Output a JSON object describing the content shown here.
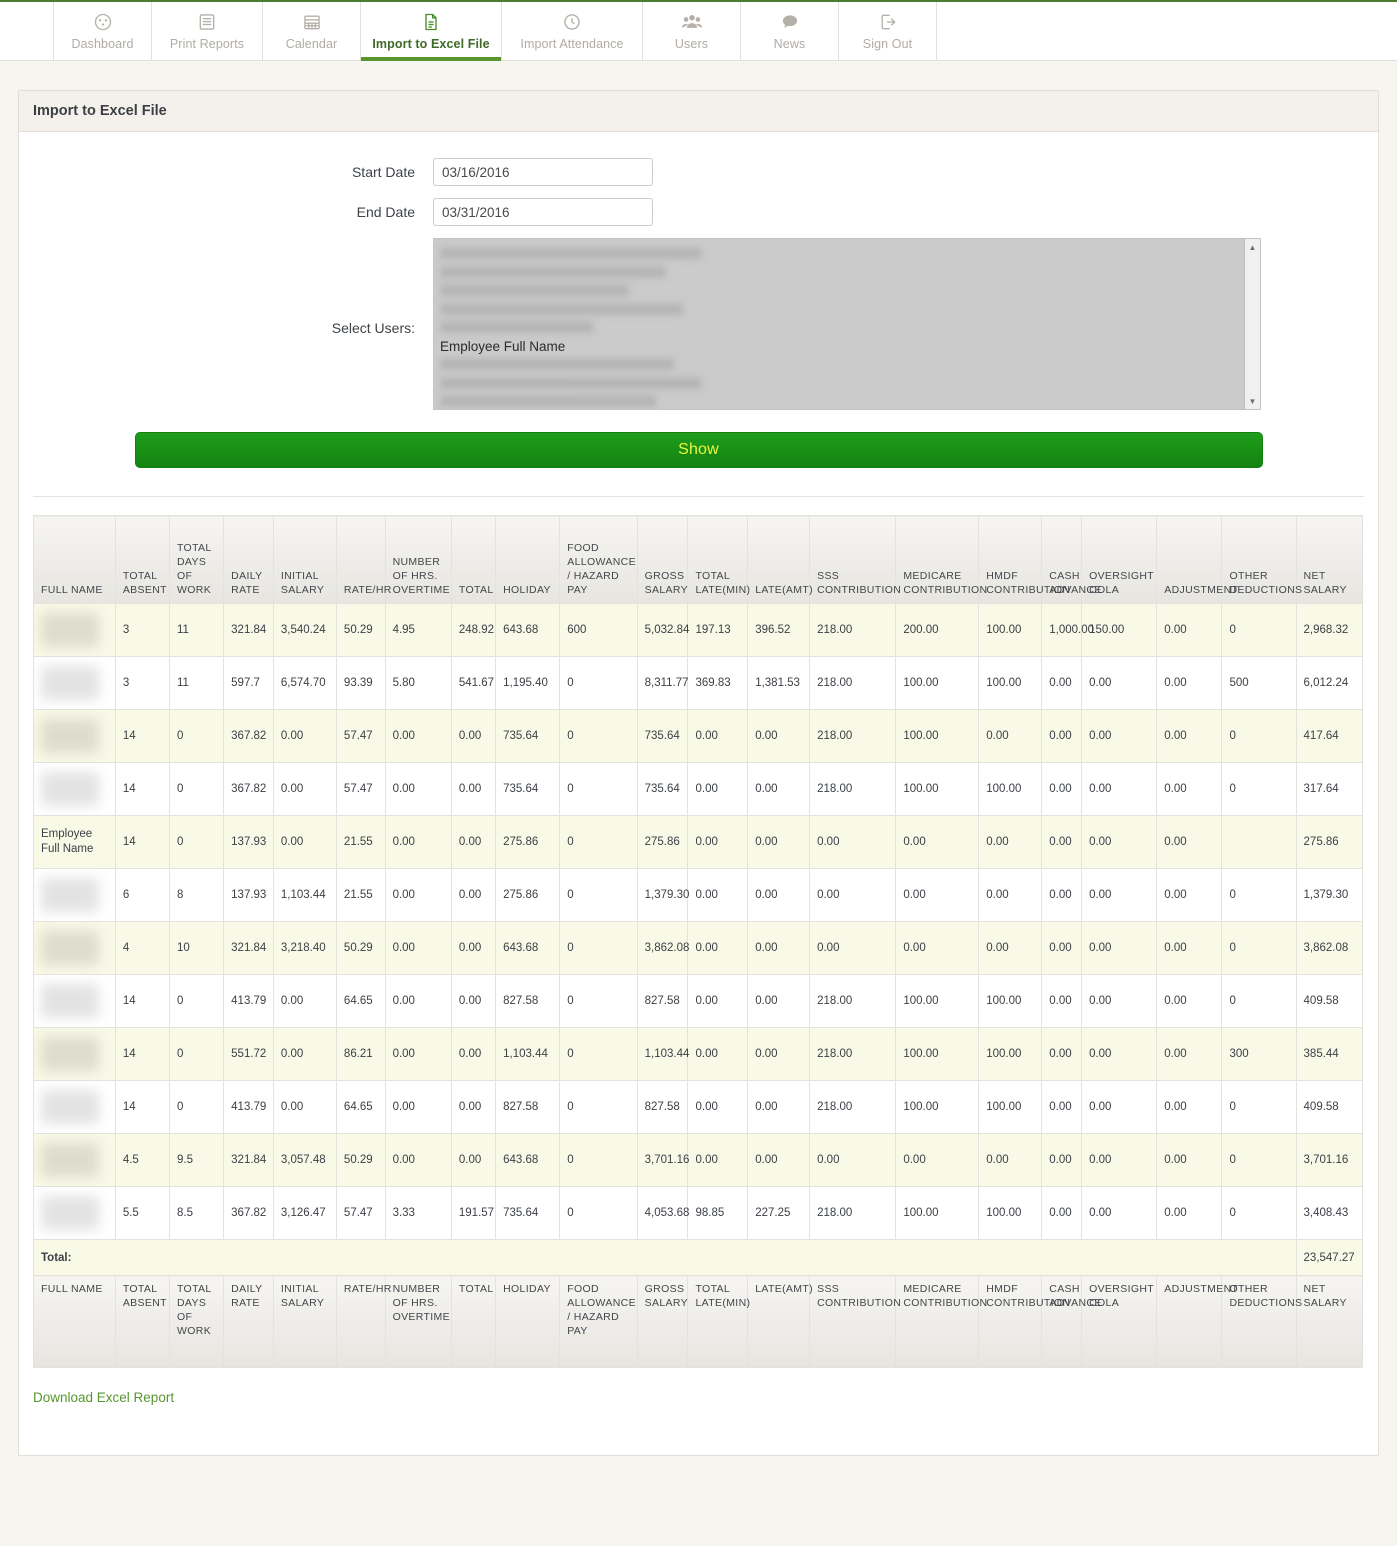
{
  "nav": {
    "items": [
      {
        "label": "Dashboard",
        "icon": "dashboard-gauge-icon",
        "active": false,
        "width": "normal"
      },
      {
        "label": "Print Reports",
        "icon": "document-list-icon",
        "active": false,
        "width": "wide"
      },
      {
        "label": "Calendar",
        "icon": "calendar-icon",
        "active": false,
        "width": "normal"
      },
      {
        "label": "Import to Excel File",
        "icon": "excel-file-icon",
        "active": true,
        "width": "xwide"
      },
      {
        "label": "Import Attendance",
        "icon": "clock-icon",
        "active": false,
        "width": "xwide"
      },
      {
        "label": "Users",
        "icon": "users-group-icon",
        "active": false,
        "width": "normal"
      },
      {
        "label": "News",
        "icon": "speech-bubble-icon",
        "active": false,
        "width": "normal"
      },
      {
        "label": "Sign Out",
        "icon": "sign-out-icon",
        "active": false,
        "width": "normal"
      }
    ]
  },
  "panel": {
    "title": "Import to Excel File"
  },
  "form": {
    "start_date_label": "Start Date",
    "start_date_value": "03/16/2016",
    "end_date_label": "End Date",
    "end_date_value": "03/31/2016",
    "select_users_label": "Select Users:",
    "user_options": [
      {
        "label": "",
        "redacted": true
      },
      {
        "label": "",
        "redacted": true
      },
      {
        "label": "",
        "redacted": true
      },
      {
        "label": "",
        "redacted": true
      },
      {
        "label": "",
        "redacted": true
      },
      {
        "label": "Employee Full Name",
        "redacted": false
      },
      {
        "label": "",
        "redacted": true
      },
      {
        "label": "",
        "redacted": true
      },
      {
        "label": "",
        "redacted": true
      },
      {
        "label": "",
        "redacted": true
      },
      {
        "label": "",
        "redacted": true
      },
      {
        "label": "",
        "redacted": true
      },
      {
        "label": "",
        "redacted": true
      }
    ],
    "show_button_label": "Show"
  },
  "table": {
    "columns": [
      "FULL NAME",
      "TOTAL ABSENT",
      "TOTAL DAYS OF WORK",
      "DAILY RATE",
      "INITIAL SALARY",
      "RATE/HR",
      "NUMBER OF HRS. OVERTIME",
      "TOTAL",
      "HOLIDAY",
      "FOOD ALLOWANCE / HAZARD PAY",
      "GROSS SALARY",
      "TOTAL LATE(MIN)",
      "LATE(AMT)",
      "SSS CONTRIBUTION",
      "MEDICARE CONTRIBUTION",
      "HMDF CONTRIBUTION",
      "CASH ADVANCE",
      "OVERSIGHT COLA",
      "ADJUSTMENT",
      "OTHER DEDUCTIONS",
      "NET SALARY"
    ],
    "rows": [
      {
        "name": "",
        "redacted": true,
        "cells": [
          "3",
          "11",
          "321.84",
          "3,540.24",
          "50.29",
          "4.95",
          "248.92",
          "643.68",
          "600",
          "5,032.84",
          "197.13",
          "396.52",
          "218.00",
          "200.00",
          "100.00",
          "1,000.00",
          "150.00",
          "0.00",
          "0",
          "2,968.32"
        ]
      },
      {
        "name": "",
        "redacted": true,
        "cells": [
          "3",
          "11",
          "597.7",
          "6,574.70",
          "93.39",
          "5.80",
          "541.67",
          "1,195.40",
          "0",
          "8,311.77",
          "369.83",
          "1,381.53",
          "218.00",
          "100.00",
          "100.00",
          "0.00",
          "0.00",
          "0.00",
          "500",
          "6,012.24"
        ]
      },
      {
        "name": "",
        "redacted": true,
        "cells": [
          "14",
          "0",
          "367.82",
          "0.00",
          "57.47",
          "0.00",
          "0.00",
          "735.64",
          "0",
          "735.64",
          "0.00",
          "0.00",
          "218.00",
          "100.00",
          "0.00",
          "0.00",
          "0.00",
          "0.00",
          "0",
          "417.64"
        ]
      },
      {
        "name": "",
        "redacted": true,
        "cells": [
          "14",
          "0",
          "367.82",
          "0.00",
          "57.47",
          "0.00",
          "0.00",
          "735.64",
          "0",
          "735.64",
          "0.00",
          "0.00",
          "218.00",
          "100.00",
          "100.00",
          "0.00",
          "0.00",
          "0.00",
          "0",
          "317.64"
        ]
      },
      {
        "name": "Employee Full Name",
        "redacted": false,
        "cells": [
          "14",
          "0",
          "137.93",
          "0.00",
          "21.55",
          "0.00",
          "0.00",
          "275.86",
          "0",
          "275.86",
          "0.00",
          "0.00",
          "0.00",
          "0.00",
          "0.00",
          "0.00",
          "0.00",
          "0.00",
          "",
          "275.86"
        ]
      },
      {
        "name": "",
        "redacted": true,
        "cells": [
          "6",
          "8",
          "137.93",
          "1,103.44",
          "21.55",
          "0.00",
          "0.00",
          "275.86",
          "0",
          "1,379.30",
          "0.00",
          "0.00",
          "0.00",
          "0.00",
          "0.00",
          "0.00",
          "0.00",
          "0.00",
          "0",
          "1,379.30"
        ]
      },
      {
        "name": "",
        "redacted": true,
        "cells": [
          "4",
          "10",
          "321.84",
          "3,218.40",
          "50.29",
          "0.00",
          "0.00",
          "643.68",
          "0",
          "3,862.08",
          "0.00",
          "0.00",
          "0.00",
          "0.00",
          "0.00",
          "0.00",
          "0.00",
          "0.00",
          "0",
          "3,862.08"
        ]
      },
      {
        "name": "",
        "redacted": true,
        "cells": [
          "14",
          "0",
          "413.79",
          "0.00",
          "64.65",
          "0.00",
          "0.00",
          "827.58",
          "0",
          "827.58",
          "0.00",
          "0.00",
          "218.00",
          "100.00",
          "100.00",
          "0.00",
          "0.00",
          "0.00",
          "0",
          "409.58"
        ]
      },
      {
        "name": "",
        "redacted": true,
        "cells": [
          "14",
          "0",
          "551.72",
          "0.00",
          "86.21",
          "0.00",
          "0.00",
          "1,103.44",
          "0",
          "1,103.44",
          "0.00",
          "0.00",
          "218.00",
          "100.00",
          "100.00",
          "0.00",
          "0.00",
          "0.00",
          "300",
          "385.44"
        ]
      },
      {
        "name": "",
        "redacted": true,
        "cells": [
          "14",
          "0",
          "413.79",
          "0.00",
          "64.65",
          "0.00",
          "0.00",
          "827.58",
          "0",
          "827.58",
          "0.00",
          "0.00",
          "218.00",
          "100.00",
          "100.00",
          "0.00",
          "0.00",
          "0.00",
          "0",
          "409.58"
        ]
      },
      {
        "name": "",
        "redacted": true,
        "cells": [
          "4.5",
          "9.5",
          "321.84",
          "3,057.48",
          "50.29",
          "0.00",
          "0.00",
          "643.68",
          "0",
          "3,701.16",
          "0.00",
          "0.00",
          "0.00",
          "0.00",
          "0.00",
          "0.00",
          "0.00",
          "0.00",
          "0",
          "3,701.16"
        ]
      },
      {
        "name": "",
        "redacted": true,
        "cells": [
          "5.5",
          "8.5",
          "367.82",
          "3,126.47",
          "57.47",
          "3.33",
          "191.57",
          "735.64",
          "0",
          "4,053.68",
          "98.85",
          "227.25",
          "218.00",
          "100.00",
          "100.00",
          "0.00",
          "0.00",
          "0.00",
          "0",
          "3,408.43"
        ]
      }
    ],
    "total_label": "Total:",
    "total_value": "23,547.27"
  },
  "footer": {
    "download_label": "Download Excel Report"
  }
}
